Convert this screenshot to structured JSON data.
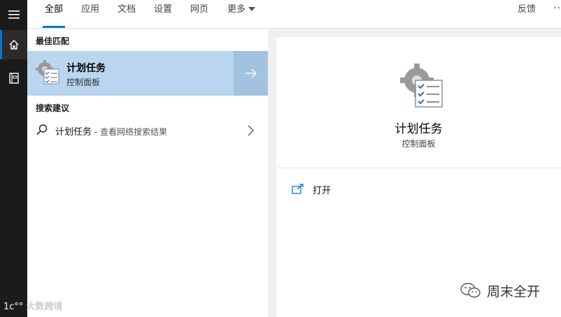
{
  "tabs": [
    {
      "label": "全部",
      "active": true
    },
    {
      "label": "应用"
    },
    {
      "label": "文档"
    },
    {
      "label": "设置"
    },
    {
      "label": "网页"
    },
    {
      "label": "更多"
    }
  ],
  "feedback_label": "反馈",
  "more_options": "···",
  "rail": {
    "icons": [
      "hamburger-menu-icon",
      "home-icon",
      "notebook-icon"
    ]
  },
  "results": {
    "best_match_heading": "最佳匹配",
    "best_match": {
      "title": "计划任务",
      "subtitle": "控制面板",
      "icon": "task-scheduler-icon"
    },
    "suggestions_heading": "搜索建议",
    "suggestion": {
      "query": "计划任务",
      "hint": " - 查看网络搜索结果"
    }
  },
  "preview": {
    "title": "计划任务",
    "subtitle": "控制面板",
    "action_open": "打开"
  },
  "watermarks": {
    "left": "1c°° 大数跨境",
    "right": "周末全开"
  },
  "colors": {
    "accent": "#0078d7",
    "selected_bg": "#b9d6ee",
    "rail_bg": "#1b1b1b"
  }
}
